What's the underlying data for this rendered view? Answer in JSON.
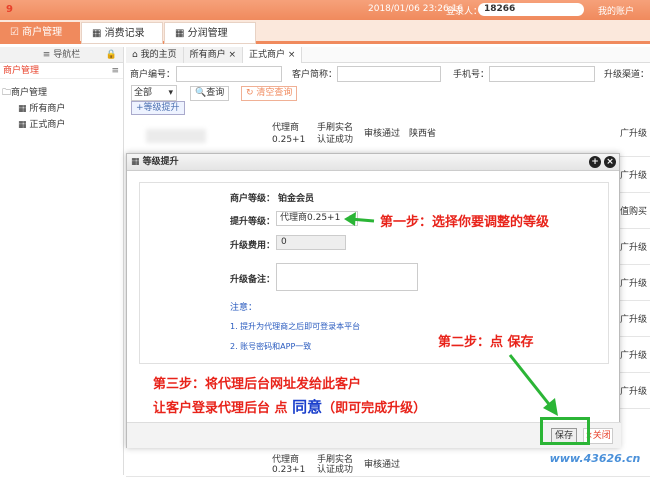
{
  "app": {
    "logo_text": "9"
  },
  "header": {
    "datetime": "2018/01/06 23:26:16",
    "login_label": "登录人：",
    "phone": "18266",
    "account": "我的账户"
  },
  "main_tabs": [
    {
      "label": "商户管理",
      "icon": "edit-icon"
    },
    {
      "label": "消费记录",
      "icon": "table-icon"
    },
    {
      "label": "分润管理",
      "icon": "table-icon"
    }
  ],
  "sidebar": {
    "title": "导航栏",
    "selected": "商户管理",
    "tree": [
      {
        "label": "商户管理"
      },
      {
        "label": "所有商户"
      },
      {
        "label": "正式商户"
      }
    ]
  },
  "content_tabs": [
    {
      "label": "我的主页"
    },
    {
      "label": "所有商户"
    },
    {
      "label": "正式商户"
    }
  ],
  "filters": {
    "merchant_no_label": "商户编号：",
    "name_label": "客户简称：",
    "phone_label": "手机号：",
    "upgrade_channel_label": "升级渠道：",
    "select_value": "全部",
    "query_button": "查询",
    "clear_button": "清空查询",
    "upgrade_button": "等级提升"
  },
  "table_rows": [
    {
      "c1": "代理商",
      "c1b": "0.25+1",
      "c2": "手刷实名",
      "c2b": "认证成功",
      "c3": "审核通过",
      "c4": "陕西省",
      "c5": "广升级"
    },
    {
      "c5": "广升级"
    },
    {
      "c5": "值购买"
    },
    {
      "c5": "广升级"
    },
    {
      "c5": "广升级"
    },
    {
      "c5": "广升级"
    },
    {
      "c5": "广升级"
    },
    {
      "c5": "广升级"
    },
    {
      "c1": "代理商",
      "c1b": "0.23+1",
      "c2": "手刷实名",
      "c2b": "认证成功",
      "c3": "审核通过"
    }
  ],
  "dialog": {
    "title": "等级提升",
    "merchant_level_label": "商户等级：",
    "merchant_level_value": "铂金会员",
    "upgrade_level_label": "提升等级：",
    "upgrade_level_value": "代理商0.25+1",
    "fee_label": "升级费用：",
    "fee_value": "0",
    "remark_label": "升级备注：",
    "note_title": "注意：",
    "note_1": "1. 提升为代理商之后即可登录本平台",
    "note_2": "2. 账号密码和APP一致",
    "save_button": "保存",
    "close_button": "关闭"
  },
  "annotations": {
    "step1": "第一步：选择你要调整的等级",
    "step2": "第二步：点 保存",
    "step3_line1": "第三步：将代理后台网址发给此客户",
    "step3_line2a": "让客户登录代理后台 点 ",
    "step3_line2b": "同意",
    "step3_line2c": "（即可完成升级）",
    "watermark": "www.43626.cn"
  },
  "colors": {
    "brand": "#f08a5d",
    "annotation_red": "#e8231a",
    "arrow_green": "#2bb536",
    "note_blue": "#2a5bbf"
  }
}
